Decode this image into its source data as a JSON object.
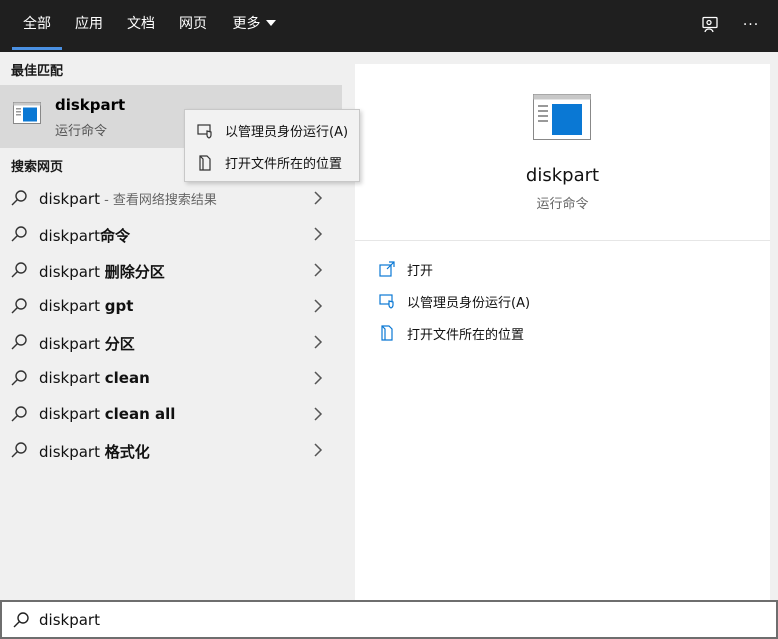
{
  "tabs": [
    {
      "label": "全部",
      "active": true
    },
    {
      "label": "应用"
    },
    {
      "label": "文档"
    },
    {
      "label": "网页"
    },
    {
      "label": "更多"
    }
  ],
  "top_icons": {
    "feedback": "feedback-icon",
    "more": "···"
  },
  "left": {
    "best_match_label": "最佳匹配",
    "best_match": {
      "title": "diskpart",
      "subtitle": "运行命令",
      "icon": "app-window-icon"
    },
    "web_label": "搜索网页",
    "results": [
      {
        "prefix": "diskpart",
        "bold": "",
        "hint": " - 查看网络搜索结果"
      },
      {
        "prefix": "diskpart",
        "bold": "命令",
        "hint": ""
      },
      {
        "prefix": "diskpart ",
        "bold": "删除分区",
        "hint": ""
      },
      {
        "prefix": "diskpart ",
        "bold": "gpt",
        "hint": ""
      },
      {
        "prefix": "diskpart ",
        "bold": "分区",
        "hint": ""
      },
      {
        "prefix": "diskpart ",
        "bold": "clean",
        "hint": ""
      },
      {
        "prefix": "diskpart ",
        "bold": "clean all",
        "hint": ""
      },
      {
        "prefix": "diskpart ",
        "bold": "格式化",
        "hint": ""
      }
    ]
  },
  "context_menu": [
    {
      "label": "以管理员身份运行(A)",
      "icon": "shield-icon"
    },
    {
      "label": "打开文件所在的位置",
      "icon": "file-location-icon"
    }
  ],
  "right": {
    "title": "diskpart",
    "subtitle": "运行命令",
    "actions": [
      {
        "label": "打开",
        "icon": "open-icon"
      },
      {
        "label": "以管理员身份运行(A)",
        "icon": "shield-icon"
      },
      {
        "label": "打开文件所在的位置",
        "icon": "file-location-icon"
      }
    ]
  },
  "search": {
    "value": "diskpart"
  },
  "colors": {
    "accent": "#4a90e2",
    "topbar": "#1f1f1f",
    "selected": "#d9d9d9",
    "icon_blue": "#0a78d4"
  }
}
